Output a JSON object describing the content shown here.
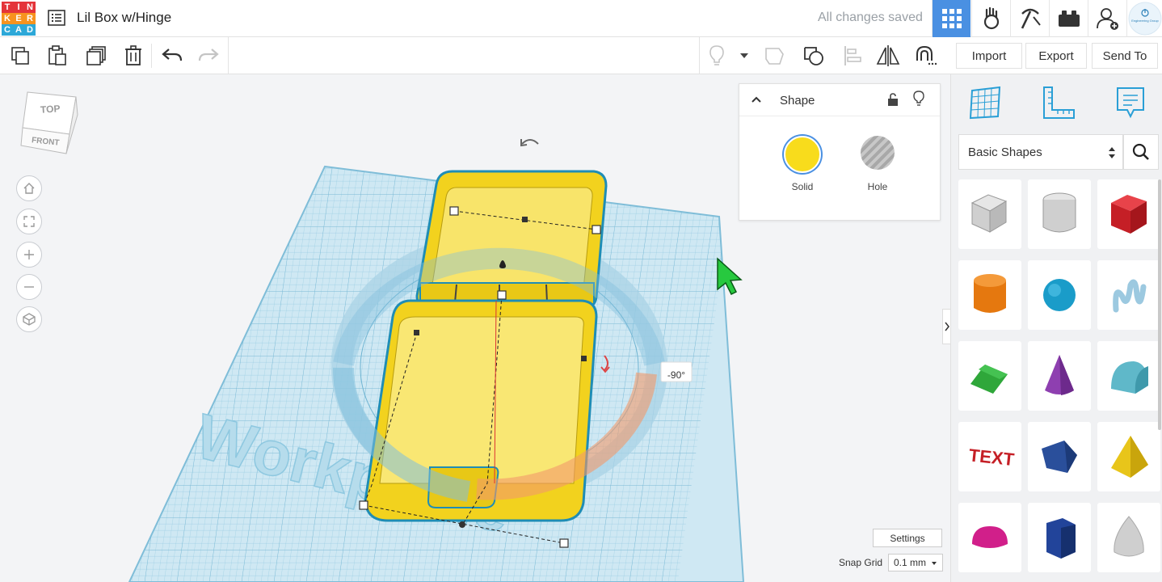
{
  "app": {
    "logo_letters": [
      "T",
      "I",
      "N",
      "K",
      "E",
      "R",
      "C",
      "A",
      "D"
    ],
    "logo_colors": [
      "#e4343a",
      "#e4343a",
      "#e4343a",
      "#f7931e",
      "#f7931e",
      "#f7931e",
      "#2da8d8",
      "#2da8d8",
      "#2da8d8"
    ],
    "title": "Lil Box w/Hinge",
    "save_status": "All changes saved",
    "account_label": "Engineering Group"
  },
  "actions": {
    "import": "Import",
    "export": "Export",
    "send_to": "Send To"
  },
  "viewcube": {
    "top": "TOP",
    "front": "FRONT"
  },
  "shape_panel": {
    "title": "Shape",
    "options": [
      {
        "label": "Solid",
        "color": "#f8dc1c"
      },
      {
        "label": "Hole",
        "color": "#bfbfbf"
      }
    ]
  },
  "library": {
    "category": "Basic Shapes",
    "shapes": [
      {
        "name": "box-hole"
      },
      {
        "name": "cylinder-hole"
      },
      {
        "name": "box"
      },
      {
        "name": "cylinder"
      },
      {
        "name": "sphere"
      },
      {
        "name": "scribble"
      },
      {
        "name": "roof"
      },
      {
        "name": "cone"
      },
      {
        "name": "round-roof"
      },
      {
        "name": "text"
      },
      {
        "name": "polygon"
      },
      {
        "name": "pyramid"
      },
      {
        "name": "half-sphere"
      },
      {
        "name": "prism"
      },
      {
        "name": "paraboloid"
      }
    ]
  },
  "scene": {
    "rotation_readout": "-90°",
    "workplane_label": "Workplane"
  },
  "footer": {
    "settings": "Settings",
    "snap_label": "Snap Grid",
    "snap_value": "0.1 mm"
  }
}
